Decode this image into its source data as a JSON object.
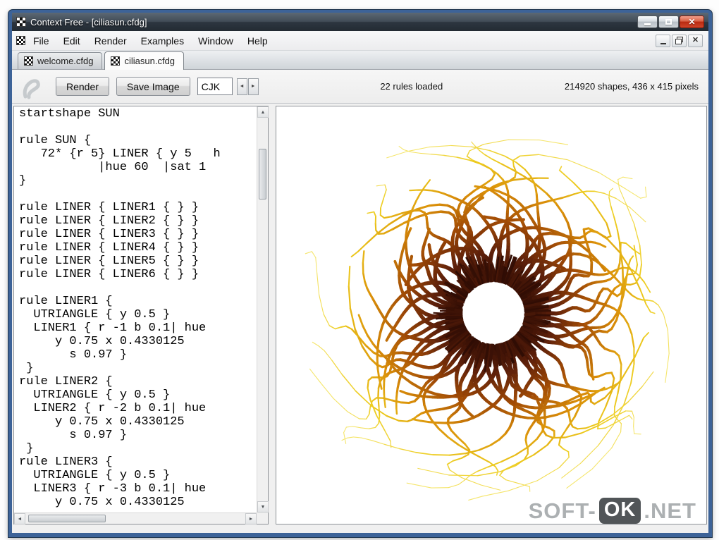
{
  "window": {
    "title": "Context Free - [ciliasun.cfdg]"
  },
  "icons": {
    "close_x": "✕",
    "spin_left": "◄",
    "spin_right": "►",
    "scroll_up": "▲",
    "scroll_down": "▼",
    "scroll_left": "◄",
    "scroll_right": "►"
  },
  "menu": {
    "items": [
      "File",
      "Edit",
      "Render",
      "Examples",
      "Window",
      "Help"
    ]
  },
  "tabs": [
    {
      "label": "welcome.cfdg"
    },
    {
      "label": "ciliasun.cfdg"
    }
  ],
  "toolbar": {
    "render_label": "Render",
    "save_label": "Save Image",
    "variation_value": "CJK",
    "rules_status": "22 rules loaded",
    "render_status": "214920 shapes, 436 x 415 pixels"
  },
  "editor": {
    "code": "startshape SUN\n\nrule SUN {\n   72* {r 5} LINER { y 5   h\n           |hue 60  |sat 1\n}\n\nrule LINER { LINER1 { } }\nrule LINER { LINER2 { } }\nrule LINER { LINER3 { } }\nrule LINER { LINER4 { } }\nrule LINER { LINER5 { } }\nrule LINER { LINER6 { } }\n\nrule LINER1 {\n  UTRIANGLE { y 0.5 }\n  LINER1 { r -1 b 0.1| hue\n     y 0.75 x 0.4330125\n       s 0.97 }\n }\nrule LINER2 {\n  UTRIANGLE { y 0.5 }\n  LINER2 { r -2 b 0.1| hue\n     y 0.75 x 0.4330125\n       s 0.97 }\n }\nrule LINER3 {\n  UTRIANGLE { y 0.5 }\n  LINER3 { r -3 b 0.1| hue\n     y 0.75 x 0.4330125"
  },
  "canvas": {
    "sun": {
      "arms": 72,
      "inner_radius": 48,
      "ring_spikes": 190,
      "palette": [
        "#2e0c04",
        "#5e200a",
        "#a14b06",
        "#d98d08",
        "#edcb1e",
        "#f5e66e"
      ],
      "background": "#ffffff"
    }
  },
  "watermark": {
    "part1": "SOFT-",
    "badge": "OK",
    "part2": ".NET"
  }
}
